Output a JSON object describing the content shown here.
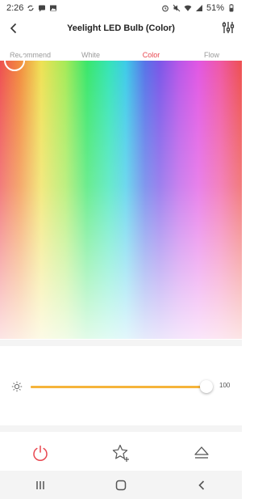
{
  "status_bar": {
    "time": "2:26",
    "battery_text": "51%",
    "left_icons": [
      "sync-icon",
      "message-icon",
      "image-icon"
    ],
    "right_icons": [
      "alarm-icon",
      "mute-icon",
      "wifi-icon",
      "signal-icon",
      "battery-icon"
    ]
  },
  "header": {
    "title": "Yeelight LED Bulb (Color)",
    "back_icon": "back-arrow-icon",
    "settings_icon": "sliders-icon"
  },
  "tabs": [
    {
      "label": "Recommend",
      "active": false
    },
    {
      "label": "White",
      "active": false
    },
    {
      "label": "Color",
      "active": true
    },
    {
      "label": "Flow",
      "active": false
    }
  ],
  "colors": {
    "accent": "#e8464f",
    "slider": "#f5b43b",
    "inactive_tab": "#9a9a9a"
  },
  "brightness": {
    "value_label": "100",
    "level": 1.0,
    "icon": "sun-icon"
  },
  "actions": [
    {
      "icon": "power-icon"
    },
    {
      "icon": "star-plus-icon"
    },
    {
      "icon": "eject-icon"
    }
  ],
  "nav": [
    {
      "icon": "recents-icon"
    },
    {
      "icon": "home-icon"
    },
    {
      "icon": "back-icon"
    }
  ]
}
